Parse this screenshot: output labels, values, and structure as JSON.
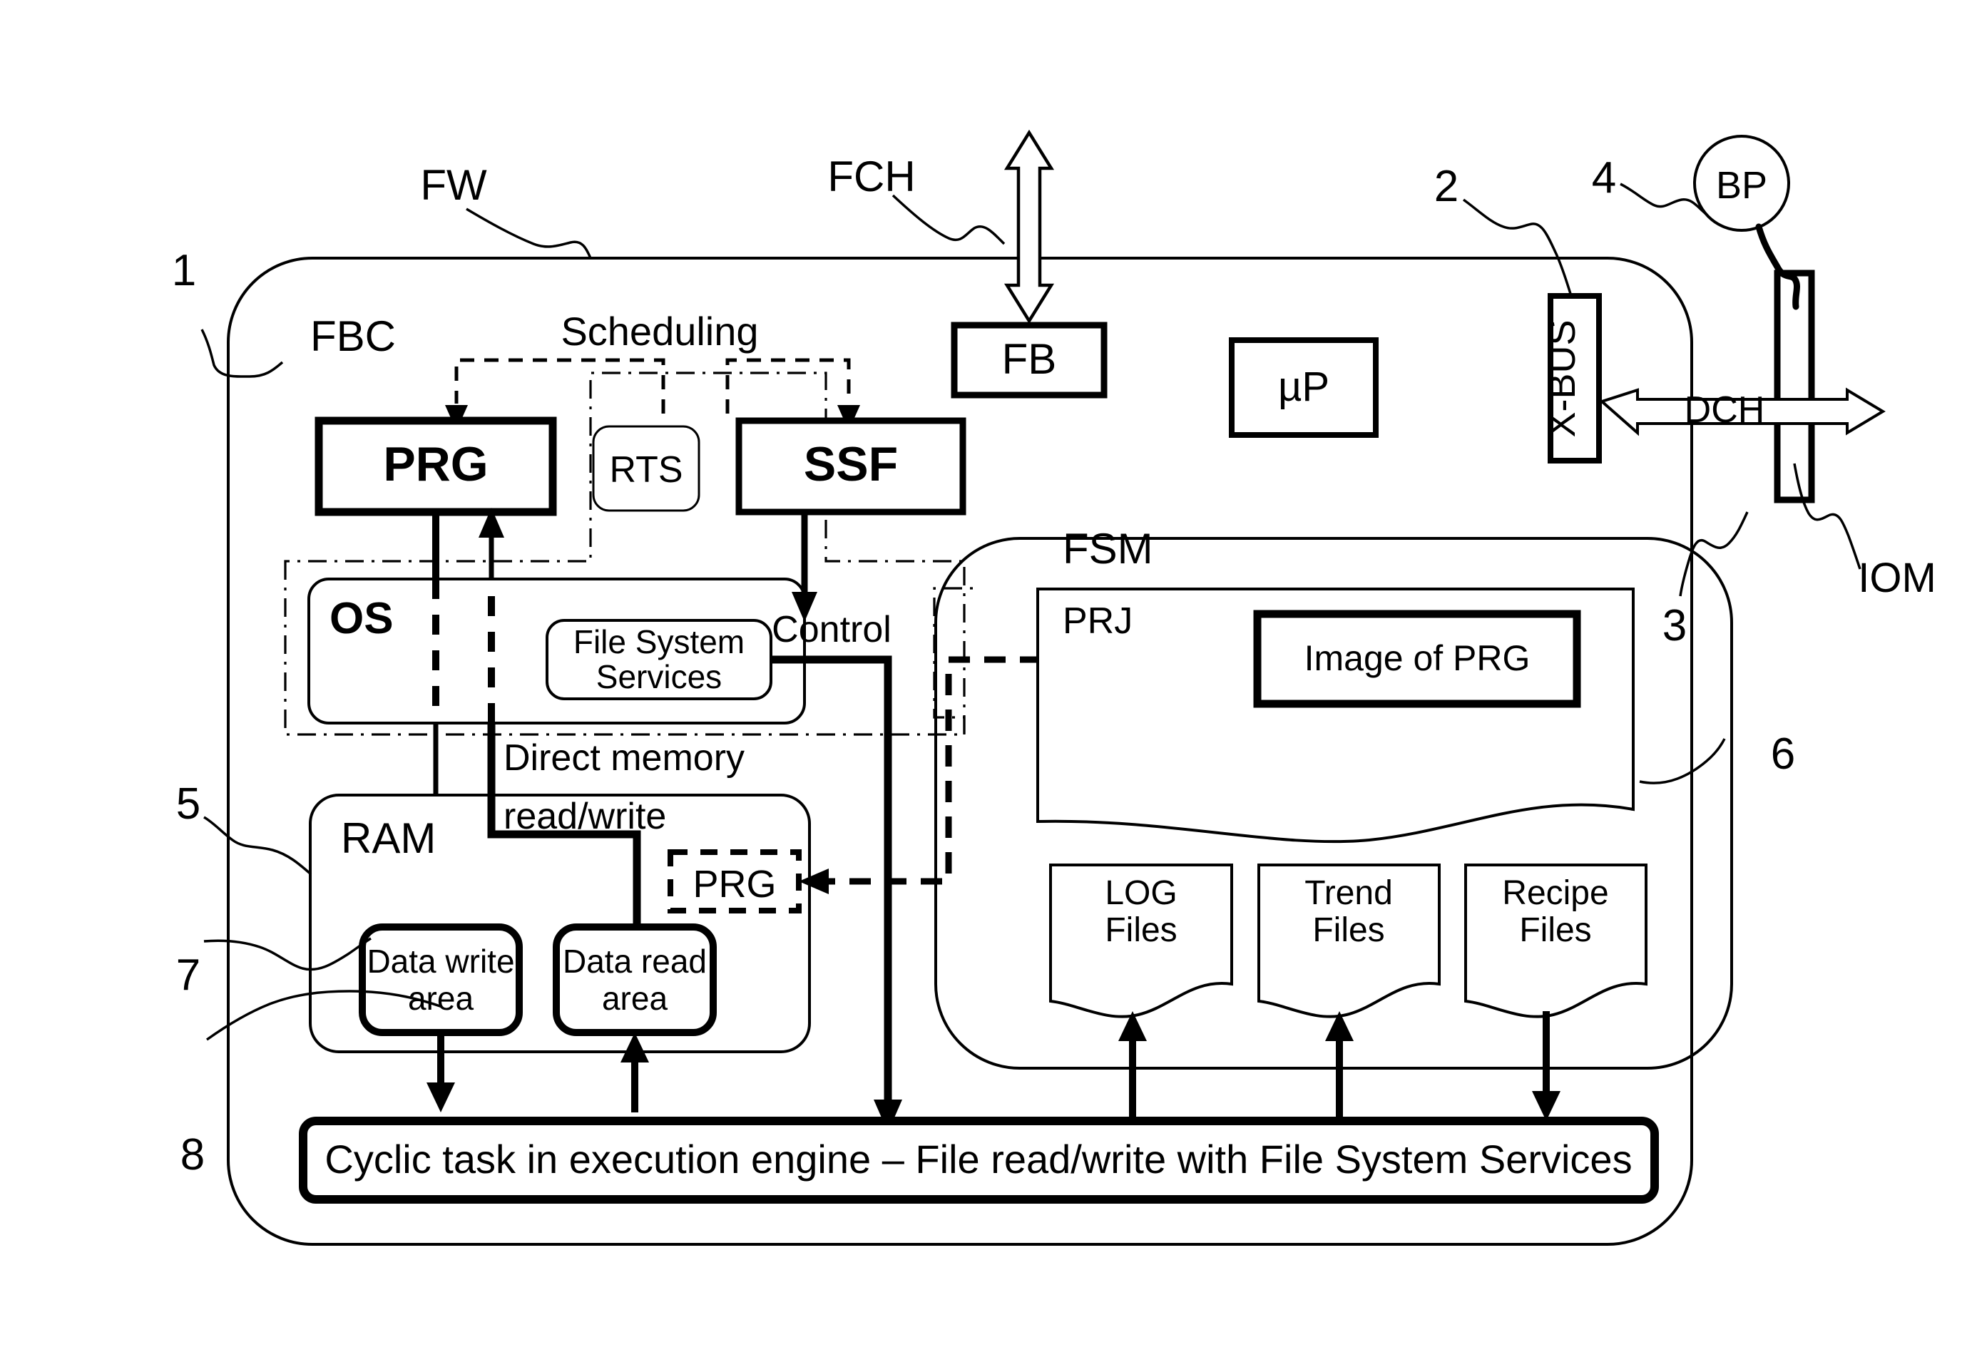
{
  "diagram": {
    "title_absent": true,
    "outer": {
      "label": "FW",
      "ref": "1"
    },
    "inner_region_label": "FBC",
    "blocks": {
      "prg_top": "PRG",
      "rts": "RTS",
      "ssf": "SSF",
      "fb": "FB",
      "up": "µP",
      "xbus": "X-BUS",
      "bp": "BP",
      "iom_ref": "IOM",
      "os": "OS",
      "file_system_services": "File System\nServices",
      "fss_line1": "File System",
      "fss_line2": "Services",
      "ram": "RAM",
      "prg_ram": "PRG",
      "data_write_line1": "Data write",
      "data_write_line2": "area",
      "data_read_line1": "Data read",
      "data_read_line2": "area",
      "fsm": "FSM",
      "prj": "PRJ",
      "image_of_prg": "Image of PRG",
      "log_files_line1": "LOG",
      "log_files_line2": "Files",
      "trend_files_line1": "Trend",
      "trend_files_line2": "Files",
      "recipe_files_line1": "Recipe",
      "recipe_files_line2": "Files",
      "cyclic_task": "Cyclic task in execution engine – File read/write with File System Services"
    },
    "edge_labels": {
      "scheduling": "Scheduling",
      "control": "Control",
      "direct_memory": "Direct memory",
      "read_write": "read/write",
      "fch": "FCH",
      "dch": "DCH"
    },
    "reference_numerals": {
      "one": "1",
      "two": "2",
      "three": "3",
      "four": "4",
      "five": "5",
      "six": "6",
      "seven": "7",
      "eight": "8"
    },
    "colors": {
      "ink": "#000000",
      "paper": "#ffffff"
    }
  }
}
